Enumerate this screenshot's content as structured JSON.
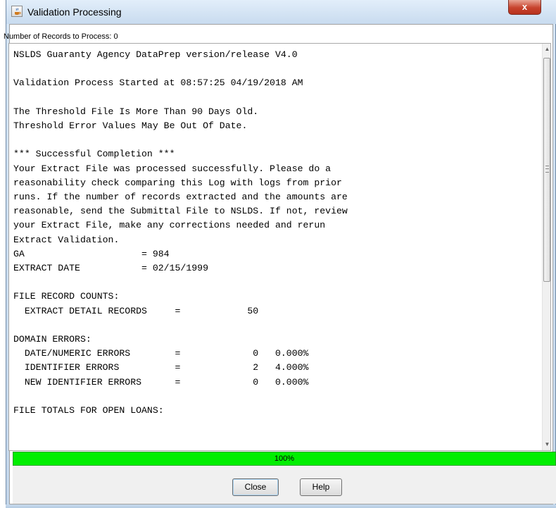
{
  "window": {
    "title": "Validation Processing",
    "close_glyph": "x"
  },
  "header": {
    "records_label": "Number of Records to Process:  0"
  },
  "log": {
    "lines": [
      "NSLDS Guaranty Agency DataPrep version/release V4.0",
      "",
      "Validation Process Started at 08:57:25 04/19/2018 AM",
      "",
      "The Threshold File Is More Than 90 Days Old.",
      "Threshold Error Values May Be Out Of Date.",
      "",
      "*** Successful Completion ***",
      "Your Extract File was processed successfully. Please do a",
      "reasonability check comparing this Log with logs from prior",
      "runs. If the number of records extracted and the amounts are",
      "reasonable, send the Submittal File to NSLDS. If not, review",
      "your Extract File, make any corrections needed and rerun",
      "Extract Validation.",
      "GA                     = 984",
      "EXTRACT DATE           = 02/15/1999",
      "",
      "FILE RECORD COUNTS:",
      "  EXTRACT DETAIL RECORDS     =            50",
      "",
      "DOMAIN ERRORS:",
      "  DATE/NUMERIC ERRORS        =             0   0.000%",
      "  IDENTIFIER ERRORS          =             2   4.000%",
      "  NEW IDENTIFIER ERRORS      =             0   0.000%",
      "",
      "FILE TOTALS FOR OPEN LOANS:"
    ]
  },
  "progress": {
    "percent": 100,
    "label": "100%",
    "color": "#00ee00"
  },
  "buttons": {
    "close_label": "Close",
    "help_label": "Help"
  },
  "colors": {
    "titlebar": "#c8dbef",
    "close_button": "#c7432d",
    "panel": "#f0f0f0"
  },
  "icons": {
    "app": "java-cup-icon",
    "scroll_up": "arrow-up-icon",
    "scroll_down": "arrow-down-icon"
  }
}
